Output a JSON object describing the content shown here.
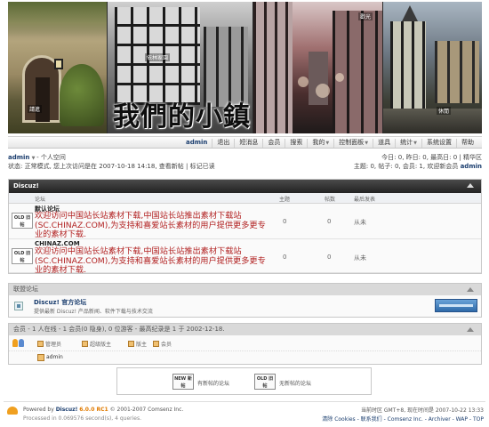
{
  "banner": {
    "title": "我們的小鎮",
    "tags": [
      "請進",
      "依林家園",
      "歡光",
      "休閒"
    ]
  },
  "nav": {
    "items": [
      "admin",
      "退出",
      "短消息",
      "会员",
      "搜索",
      "我的",
      "控制面板",
      "道具",
      "统计",
      "系统设置",
      "帮助"
    ]
  },
  "user": {
    "name": "admin",
    "space": "个人空间",
    "status": "状态: 正常模式, 您上次访问是在 2007-10-18 14:18, 查看新帖 | 标记已读",
    "today": "今日: 0, 昨日: 0, 最高日: 0 | 精华区",
    "stats_prefix": "主题: 0, 帖子: 0, 会员: 1, 欢迎新会员",
    "newest_member": "admin"
  },
  "forum": {
    "category": "Discuz!",
    "columns": [
      "论坛",
      "主题",
      "帖数",
      "最后发表"
    ],
    "rows": [
      {
        "name": "默认论坛",
        "icon_label": "OLD 旧帖",
        "description": "欢迎访问中国站长站素材下载,中国站长站推出素材下载站(SC.CHINAZ.COM),为支持和喜爱站长素材的用户提供更多更专业的素材下载.",
        "threads": "0",
        "posts": "0",
        "lastpost": "从未"
      },
      {
        "name": "CHINAZ.COM",
        "icon_label": "OLD 旧帖",
        "description": "欢迎访问中国站长站素材下载,中国站长站推出素材下载站(SC.CHINAZ.COM),为支持和喜爱站长素材的用户提供更多更专业的素材下载.",
        "threads": "0",
        "posts": "0",
        "lastpost": "从未"
      }
    ]
  },
  "links": {
    "header": "联盟论坛",
    "name": "Discuz! 官方论坛",
    "desc": "提供最新 Discuz! 产品新闻、软件下载与技术交流"
  },
  "online": {
    "header": "会员 - 1 人在线 - 1 会员(0 隐身), 0 位游客 - 最高纪录是 1 于 2002-12-18.",
    "legend": [
      "管理员",
      "超级版主",
      "版主",
      "会员"
    ],
    "users": [
      "admin"
    ]
  },
  "icon_legend": [
    {
      "icon": "NEW 新帖",
      "label": "有新帖的论坛"
    },
    {
      "icon": "OLD 旧帖",
      "label": "无新帖的论坛"
    }
  ],
  "footer": {
    "powered_prefix": "Powered by",
    "product": "Discuz!",
    "version": "6.0.0 RC1",
    "copyright": "© 2001-2007 Comsenz Inc.",
    "processed": "Processed in 0.069576 second(s), 4 queries.",
    "timezone": "当前时区 GMT+8, 现在时间是 2007-10-22 13:33",
    "links": "清除 Cookies - 联系我们 - Comsenz Inc. - Archiver - WAP - TOP"
  },
  "colors": {
    "accent": "#1a3d6e",
    "description_red": "#b22222",
    "header_dark": "#2b2b2b"
  }
}
